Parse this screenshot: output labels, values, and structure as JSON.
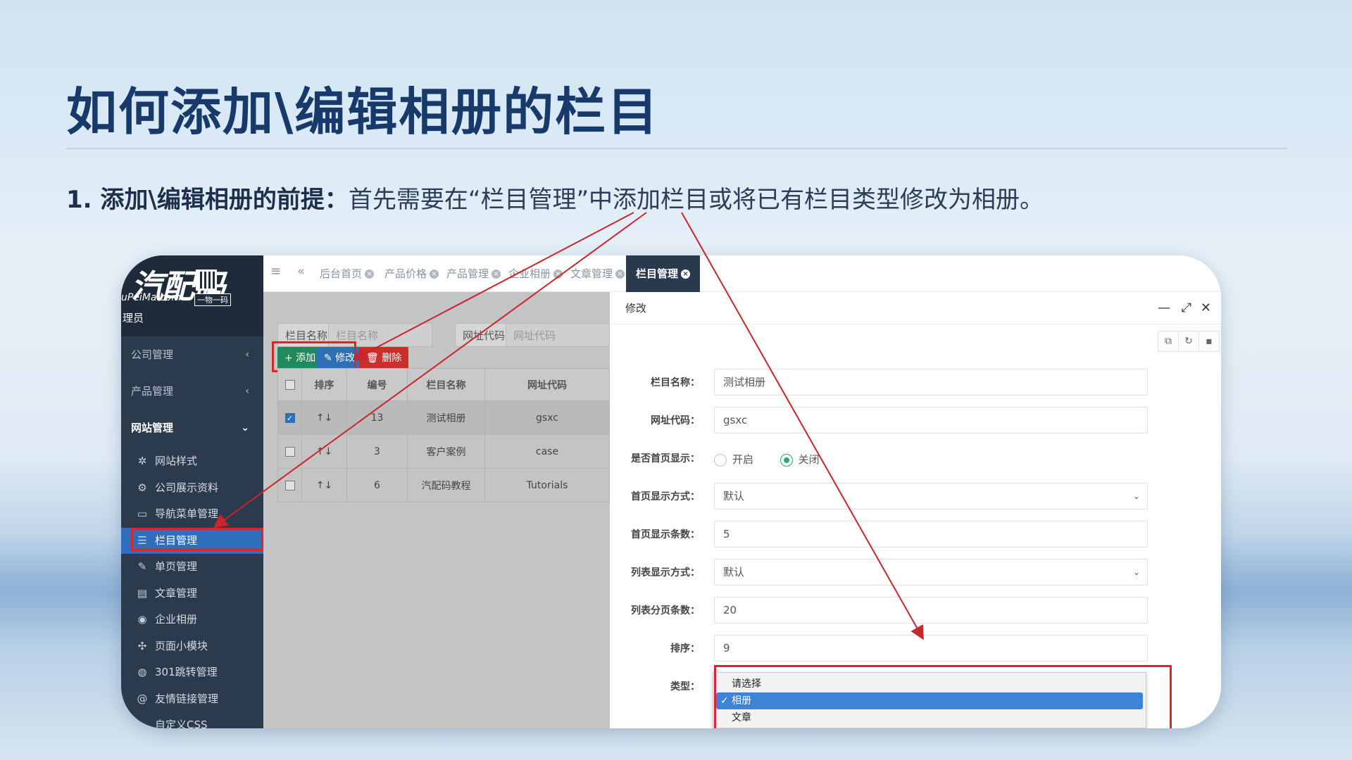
{
  "slide": {
    "title": "如何添加\\编辑相册的栏目",
    "step_label": "1. 添加\\编辑相册的前提：",
    "step_text": "首先需要在“栏目管理”中添加栏目或将已有栏目类型修改为相册。"
  },
  "logo": {
    "main": "汽配码",
    "url": "uPeiMa.com",
    "slogan": "一物一码",
    "role": "理员"
  },
  "sidebar": {
    "groups": [
      {
        "label": "公司管理",
        "chev": "‹"
      },
      {
        "label": "产品管理",
        "chev": "‹"
      },
      {
        "label": "网站管理",
        "chev": "⌄"
      }
    ],
    "items": [
      {
        "label": "网站样式",
        "icon": "✲"
      },
      {
        "label": "公司展示资料",
        "icon": "⚙"
      },
      {
        "label": "导航菜单管理",
        "icon": "▭"
      },
      {
        "label": "栏目管理",
        "icon": "☰"
      },
      {
        "label": "单页管理",
        "icon": "✎"
      },
      {
        "label": "文章管理",
        "icon": "▤"
      },
      {
        "label": "企业相册",
        "icon": "◉"
      },
      {
        "label": "页面小模块",
        "icon": "✣"
      },
      {
        "label": "301跳转管理",
        "icon": "◍"
      },
      {
        "label": "友情链接管理",
        "icon": "@"
      },
      {
        "label": "自定义CSS",
        "icon": "✒"
      }
    ]
  },
  "tabs": [
    {
      "label": "后台首页"
    },
    {
      "label": "产品价格"
    },
    {
      "label": "产品管理"
    },
    {
      "label": "企业相册"
    },
    {
      "label": "文章管理"
    },
    {
      "label": "栏目管理"
    }
  ],
  "filters": {
    "name_label": "栏目名称",
    "name_placeholder": "栏目名称",
    "code_label": "网址代码",
    "code_placeholder": "网址代码"
  },
  "toolbar": {
    "add": "+ 添加",
    "edit": "✎ 修改",
    "delete": "🗑 删除"
  },
  "table": {
    "headers": [
      "排序",
      "编号",
      "栏目名称",
      "网址代码"
    ],
    "rows": [
      {
        "sort": "↑↓",
        "id": "13",
        "name": "测试相册",
        "code": "gsxc",
        "checked": true
      },
      {
        "sort": "↑↓",
        "id": "3",
        "name": "客户案例",
        "code": "case",
        "checked": false
      },
      {
        "sort": "↑↓",
        "id": "6",
        "name": "汽配码教程",
        "code": "Tutorials",
        "checked": false
      }
    ]
  },
  "modal": {
    "title": "修改",
    "fields": {
      "name_label": "栏目名称：",
      "name_value": "测试相册",
      "code_label": "网址代码：",
      "code_value": "gsxc",
      "home_label": "是否首页显示：",
      "home_on": "开启",
      "home_off": "关闭",
      "home_mode_label": "首页显示方式：",
      "home_mode_value": "默认",
      "home_count_label": "首页显示条数：",
      "home_count_value": "5",
      "list_mode_label": "列表显示方式：",
      "list_mode_value": "默认",
      "page_count_label": "列表分页条数：",
      "page_count_value": "20",
      "sort_label": "排序：",
      "sort_value": "9",
      "type_label": "类型："
    },
    "type_options": [
      "请选择",
      "相册",
      "文章"
    ],
    "type_selected": "相册"
  },
  "colors": {
    "sidebar": "#2b3a4c",
    "accent": "#2f6fb9",
    "highlight_red": "#d8262c",
    "title": "#173a6b"
  }
}
